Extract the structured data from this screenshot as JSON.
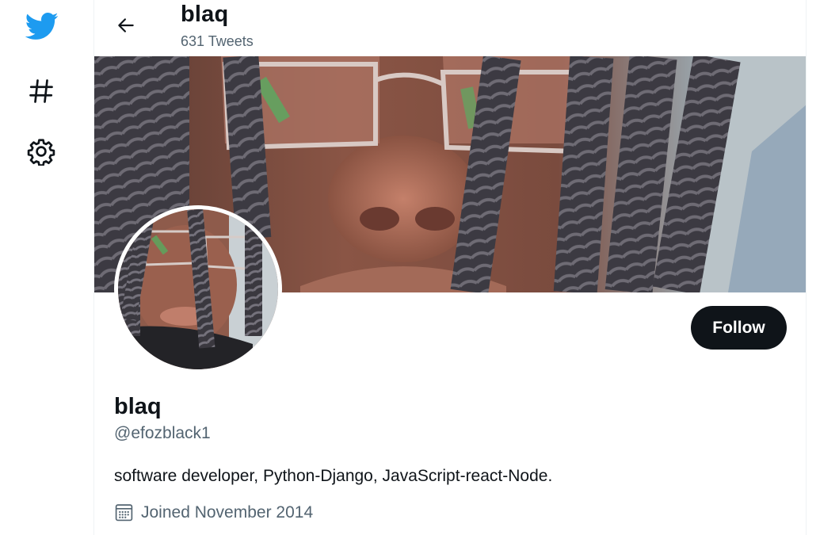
{
  "nav": {
    "items": [
      {
        "icon": "twitter-bird-icon",
        "color": "#1d9bf0"
      },
      {
        "icon": "hashtag-icon"
      },
      {
        "icon": "settings-gear-icon"
      }
    ]
  },
  "header": {
    "name": "blaq",
    "tweet_count": "631 Tweets"
  },
  "profile": {
    "display_name": "blaq",
    "handle": "@efozblack1",
    "bio": "software developer, Python-Django, JavaScript-react-Node.",
    "joined": "Joined November 2014",
    "follow_label": "Follow"
  },
  "colors": {
    "accent": "#1d9bf0",
    "text_primary": "#0f1419",
    "text_secondary": "#536471",
    "button_bg": "#0f1419"
  }
}
